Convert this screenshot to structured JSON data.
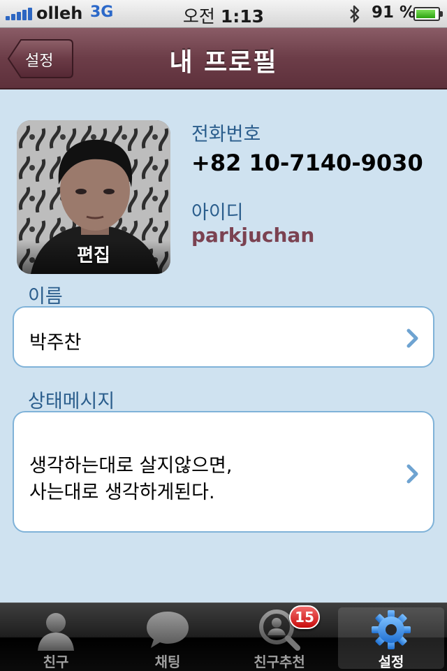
{
  "status_bar": {
    "carrier": "olleh",
    "network": "3G",
    "time_prefix": "오전",
    "time": "1:13",
    "battery_percent": "91 %",
    "battery_level": 0.91,
    "icons": [
      "signal-icon",
      "bluetooth-icon",
      "battery-icon"
    ]
  },
  "nav": {
    "back_label": "설정",
    "title": "내 프로필"
  },
  "profile": {
    "avatar_edit_label": "편집",
    "phone_label": "전화번호",
    "phone_value": "+82 10-7140-9030",
    "id_label": "아이디",
    "id_value": "parkjuchan"
  },
  "name_section": {
    "label": "이름",
    "value": "박주찬"
  },
  "status_section": {
    "label": "상태메시지",
    "line1": "생각하는대로 살지않으면,",
    "line2": "사는대로 생각하게된다."
  },
  "tabs": [
    {
      "label": "친구",
      "icon": "person-icon"
    },
    {
      "label": "채팅",
      "icon": "chat-bubble-icon"
    },
    {
      "label": "친구추천",
      "icon": "friend-search-icon",
      "badge": "15"
    },
    {
      "label": "설정",
      "icon": "gear-icon",
      "active": true
    }
  ],
  "colors": {
    "nav_bar": "#6c3d48",
    "background": "#cfe2f0",
    "label_blue": "#2a5d8c",
    "id_color": "#7b4251",
    "badge_red": "#c80c0c",
    "active_tab_icon": "#3b8fe0"
  }
}
